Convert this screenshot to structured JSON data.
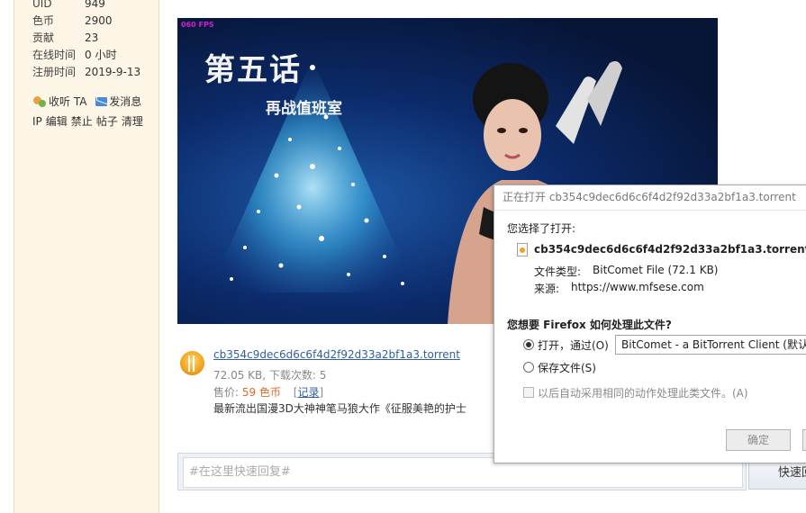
{
  "sidebar": {
    "info": [
      {
        "key": "UID",
        "value": "949"
      },
      {
        "key": "色币",
        "value": "2900"
      },
      {
        "key": "贡献",
        "value": "23"
      },
      {
        "key": "在线时间",
        "value": "0 小时"
      },
      {
        "key": "注册时间",
        "value": "2019-9-13"
      }
    ],
    "actions": {
      "listen": "收听 TA",
      "message": "发消息"
    },
    "admin": [
      "IP",
      "编辑",
      "禁止",
      "帖子",
      "清理"
    ]
  },
  "banner": {
    "fps": "060 FPS",
    "title": "第五话",
    "subtitle": "再战值班室"
  },
  "attachment": {
    "filename": "cb354c9dec6d6c6f4d2f92d33a2bf1a3.torrent",
    "meta": "72.05 KB, 下载次数: 5",
    "price_label": "售价: ",
    "price_value": "59 色币",
    "record": "记录",
    "description": "最新流出国漫3D大神神笔马狼大作《征服美艳的护士"
  },
  "reply": {
    "placeholder": "#在这里快速回复#",
    "button": "快速回复"
  },
  "dialog": {
    "title": "正在打开 cb354c9dec6d6c6f4d2f92d33a2bf1a3.torrent",
    "chosen_label": "您选择了打开:",
    "filename": "cb354c9dec6d6c6f4d2f92d33a2bf1a3.torrent",
    "type_label": "文件类型:",
    "type_value": "BitComet File (72.1 KB)",
    "source_label": "来源:",
    "source_value": "https://www.mfsese.com",
    "question": "您想要 Firefox 如何处理此文件?",
    "open_with_label": "打开，通过(O)",
    "open_with_value": "BitComet - a BitTorrent Client (默认)",
    "save_label": "保存文件(S)",
    "auto_label": "以后自动采用相同的动作处理此类文件。(A)",
    "ok_button": "确定",
    "selected_option": "open"
  }
}
